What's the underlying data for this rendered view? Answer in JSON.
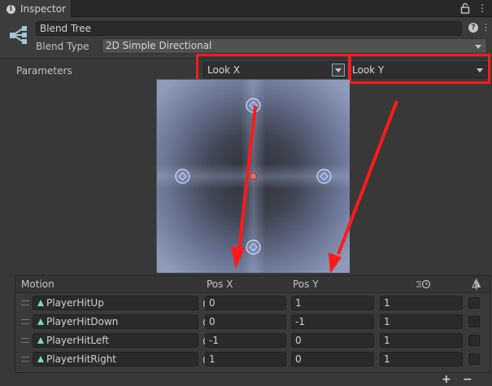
{
  "tab": {
    "title": "Inspector"
  },
  "header": {
    "name_value": "Blend Tree",
    "blend_type_label": "Blend Type",
    "blend_type_value": "2D Simple Directional"
  },
  "parameters": {
    "label": "Parameters",
    "x_param": "Look X",
    "y_param": "Look Y"
  },
  "graph": {
    "points": [
      {
        "name": "PlayerHitUp",
        "x": 0,
        "y": 1
      },
      {
        "name": "PlayerHitDown",
        "x": 0,
        "y": -1
      },
      {
        "name": "PlayerHitLeft",
        "x": -1,
        "y": 0
      },
      {
        "name": "PlayerHitRight",
        "x": 1,
        "y": 0
      }
    ],
    "current": {
      "x": 0,
      "y": 0
    }
  },
  "motion_table": {
    "headers": {
      "motion": "Motion",
      "pos_x": "Pos X",
      "pos_y": "Pos Y"
    },
    "rows": [
      {
        "clip": "PlayerHitUp",
        "pos_x": "0",
        "pos_y": "1",
        "speed": "1"
      },
      {
        "clip": "PlayerHitDown",
        "pos_x": "0",
        "pos_y": "-1",
        "speed": "1"
      },
      {
        "clip": "PlayerHitLeft",
        "pos_x": "-1",
        "pos_y": "0",
        "speed": "1"
      },
      {
        "clip": "PlayerHitRight",
        "pos_x": "1",
        "pos_y": "0",
        "speed": "1"
      }
    ],
    "add_label": "+",
    "remove_label": "−"
  },
  "colors": {
    "annotation_red": "#ff1a1a",
    "point_blue": "#6f8fe0",
    "current_red": "#e86a6a"
  }
}
